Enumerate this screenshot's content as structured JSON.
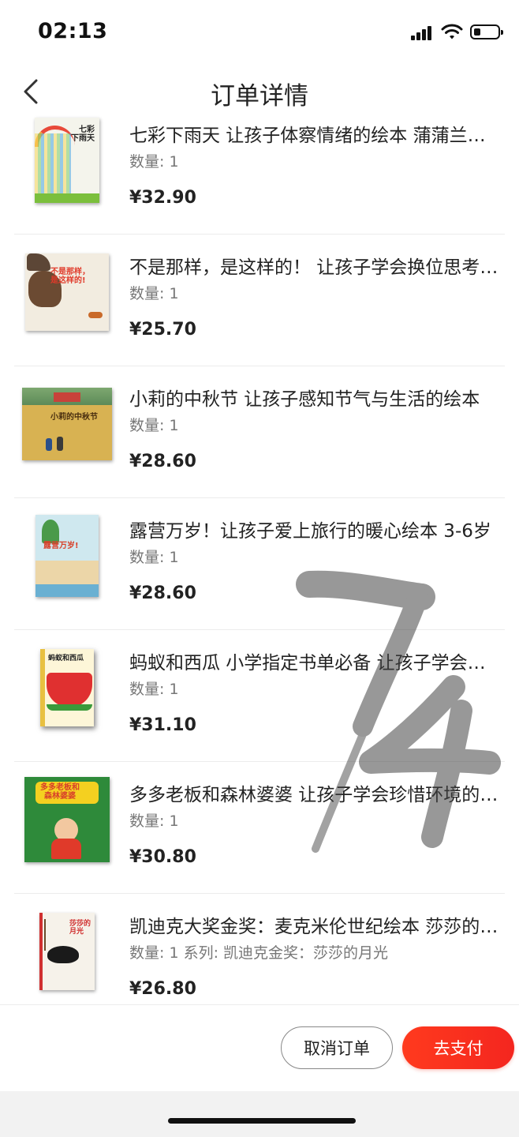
{
  "status_bar": {
    "time": "02:13"
  },
  "header": {
    "title": "订单详情"
  },
  "items": [
    {
      "title": "七彩下雨天 让孩子体察情绪的绘本 蒲蒲兰绘本馆",
      "qty": "数量: 1",
      "price": "¥32.90",
      "cover_text": "七彩\n下雨天",
      "cover_color": "#f4f4ec"
    },
    {
      "title": "不是那样，是这样的！ 让孩子学会换位思考的绘本",
      "qty": "数量: 1",
      "price": "¥25.70",
      "cover_text": "不是那样，\n是这样的!",
      "cover_color": "#f2ece0"
    },
    {
      "title": "小莉的中秋节 让孩子感知节气与生活的绘本",
      "qty": "数量: 1",
      "price": "¥28.60",
      "cover_text": "小莉的中秋节",
      "cover_color": "#d8b252"
    },
    {
      "title": "露营万岁！让孩子爱上旅行的暖心绘本 3-6岁",
      "qty": "数量: 1",
      "price": "¥28.60",
      "cover_text": "露营万岁!",
      "cover_color": "#cfe8ef"
    },
    {
      "title": "蚂蚁和西瓜 小学指定书单必备 让孩子学会合作",
      "qty": "数量: 1",
      "price": "¥31.10",
      "cover_text": "蚂蚁和西瓜",
      "cover_color": "#fdf6d8"
    },
    {
      "title": "多多老板和森林婆婆 让孩子学会珍惜环境的绘本",
      "qty": "数量: 1",
      "price": "¥30.80",
      "cover_text": "多多老板和\n森林婆婆",
      "cover_color": "#2e8a3a"
    },
    {
      "title": "凯迪克大奖金奖：麦克米伦世纪绘本 莎莎的月光",
      "qty": "数量: 1 系列: 凯迪克金奖：莎莎的月光",
      "price": "¥26.80",
      "cover_text": "莎莎的\n月光",
      "cover_color": "#f6f2ea"
    }
  ],
  "handwriting": {
    "text": "74",
    "color": "#444444"
  },
  "footer": {
    "cancel_label": "取消订单",
    "pay_label": "去支付"
  },
  "colors": {
    "accent": "#f4261f",
    "price_text": "#222222"
  },
  "icons": {
    "back": "chevron-left-icon",
    "signal": "signal-icon",
    "wifi": "wifi-icon",
    "battery": "battery-icon"
  }
}
